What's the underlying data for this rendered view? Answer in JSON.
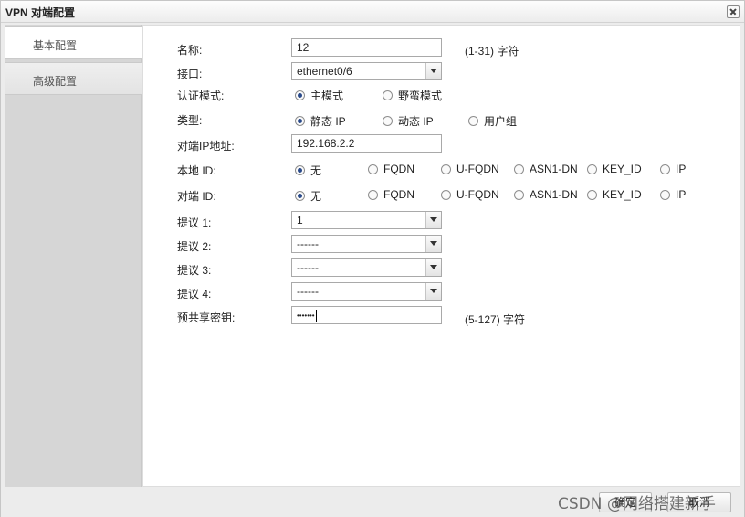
{
  "window": {
    "title": "VPN 对端配置"
  },
  "sidebar": {
    "tabs": [
      {
        "label": "基本配置"
      },
      {
        "label": "高级配置"
      }
    ]
  },
  "form": {
    "name": {
      "label": "名称:",
      "value": "12",
      "hint": "(1-31) 字符"
    },
    "interface": {
      "label": "接口:",
      "value": "ethernet0/6"
    },
    "auth_mode": {
      "label": "认证模式:",
      "options": [
        "主模式",
        "野蛮模式"
      ],
      "selected": "主模式"
    },
    "type": {
      "label": "类型:",
      "options": [
        "静态 IP",
        "动态 IP",
        "用户组"
      ],
      "selected": "静态 IP"
    },
    "peer_ip": {
      "label": "对端IP地址:",
      "value": "192.168.2.2"
    },
    "local_id": {
      "label": "本地 ID:",
      "options": [
        "无",
        "FQDN",
        "U-FQDN",
        "ASN1-DN",
        "KEY_ID",
        "IP"
      ],
      "selected": "无"
    },
    "peer_id": {
      "label": "对端 ID:",
      "options": [
        "无",
        "FQDN",
        "U-FQDN",
        "ASN1-DN",
        "KEY_ID",
        "IP"
      ],
      "selected": "无"
    },
    "proposals": [
      {
        "label": "提议 1:",
        "value": "1"
      },
      {
        "label": "提议 2:",
        "value": "------"
      },
      {
        "label": "提议 3:",
        "value": "------"
      },
      {
        "label": "提议 4:",
        "value": "------"
      }
    ],
    "psk": {
      "label": "预共享密钥:",
      "value": "•••••••",
      "hint": "(5-127) 字符"
    }
  },
  "footer": {
    "ok_label": "确定",
    "cancel_label": "取消"
  },
  "watermark": "CSDN @网络搭建新手"
}
